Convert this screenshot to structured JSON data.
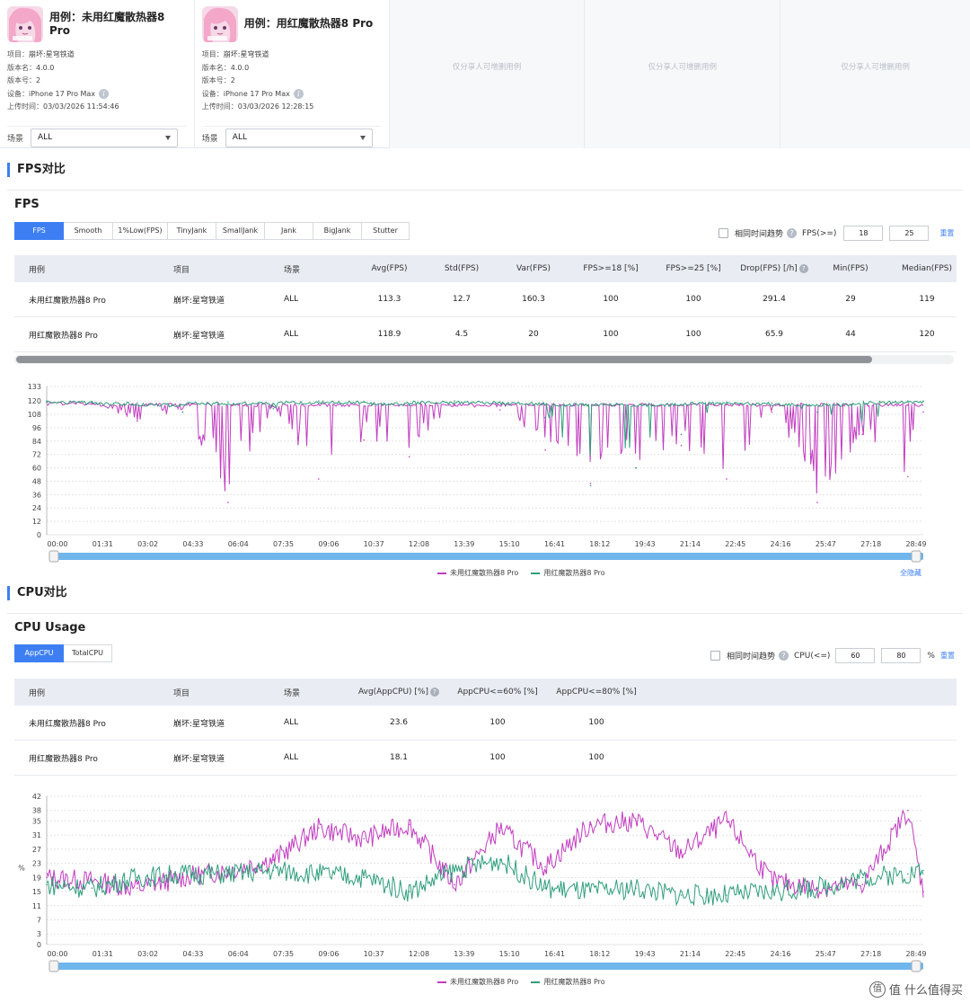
{
  "cases": [
    {
      "title": "用例：未用红魔散热器8 Pro",
      "meta": [
        {
          "label": "项目：",
          "value": "崩坏:星穹铁道"
        },
        {
          "label": "版本名：",
          "value": "4.0.0"
        },
        {
          "label": "版本号：",
          "value": "2"
        },
        {
          "label": "设备：",
          "value": "iPhone 17 Pro Max"
        },
        {
          "label": "上传时间：",
          "value": "03/03/2026 11:54:46"
        }
      ],
      "scene_label": "场景",
      "scene_value": "ALL"
    },
    {
      "title": "用例：用红魔散热器8 Pro",
      "meta": [
        {
          "label": "项目：",
          "value": "崩坏:星穹铁道"
        },
        {
          "label": "版本名：",
          "value": "4.0.0"
        },
        {
          "label": "版本号：",
          "value": "2"
        },
        {
          "label": "设备：",
          "value": "iPhone 17 Pro Max"
        },
        {
          "label": "上传时间：",
          "value": "03/03/2026 12:28:15"
        }
      ],
      "scene_label": "场景",
      "scene_value": "ALL"
    }
  ],
  "empty_slot_text": "仅分享人可增删用例",
  "fps_section": {
    "section_title": "FPS对比",
    "sub_title": "FPS",
    "tabs": [
      "FPS",
      "Smooth",
      "1%Low(FPS)",
      "TinyJank",
      "SmallJank",
      "Jank",
      "BigJank",
      "Stutter"
    ],
    "active_tab": "FPS",
    "trend_label": "相同时间趋势",
    "threshold_label": "FPS(>=)",
    "threshold_values": [
      "18",
      "25"
    ],
    "reset_label": "重置",
    "table": {
      "headers": [
        "用例",
        "项目",
        "场景",
        "Avg(FPS)",
        "Std(FPS)",
        "Var(FPS)",
        "FPS>=18 [%]",
        "FPS>=25 [%]",
        "Drop(FPS) [/h]",
        "Min(FPS)",
        "Median(FPS)"
      ],
      "rows": [
        [
          "未用红魔散热器8 Pro",
          "崩坏:星穹铁道",
          "ALL",
          "113.3",
          "12.7",
          "160.3",
          "100",
          "100",
          "291.4",
          "29",
          "119"
        ],
        [
          "用红魔散热器8 Pro",
          "崩坏:星穹铁道",
          "ALL",
          "118.9",
          "4.5",
          "20",
          "100",
          "100",
          "65.9",
          "44",
          "120"
        ]
      ]
    },
    "legend": [
      "未用红魔散热器8 Pro",
      "用红魔散热器8 Pro"
    ],
    "hide_all_label": "全隐藏"
  },
  "cpu_section": {
    "section_title": "CPU对比",
    "sub_title": "CPU Usage",
    "tabs": [
      "AppCPU",
      "TotalCPU"
    ],
    "active_tab": "AppCPU",
    "trend_label": "相同时间趋势",
    "threshold_label": "CPU(<=)",
    "threshold_values": [
      "60",
      "80"
    ],
    "unit_label": "%",
    "reset_label": "重置",
    "table": {
      "headers": [
        "用例",
        "项目",
        "场景",
        "Avg(AppCPU) [%]",
        "AppCPU<=60% [%]",
        "AppCPU<=80% [%]"
      ],
      "rows": [
        [
          "未用红魔散热器8 Pro",
          "崩坏:星穹铁道",
          "ALL",
          "23.6",
          "100",
          "100"
        ],
        [
          "用红魔散热器8 Pro",
          "崩坏:星穹铁道",
          "ALL",
          "18.1",
          "100",
          "100"
        ]
      ]
    },
    "legend": [
      "未用红魔散热器8 Pro",
      "用红魔散热器8 Pro"
    ]
  },
  "colors": {
    "accent": "#3d7ff3",
    "series_without_cooler": "#c13cc0",
    "series_with_cooler": "#2f9e7b"
  },
  "watermark": "值 什么值得买",
  "chart_data": [
    {
      "type": "line",
      "ylabel": "",
      "xlabel": "",
      "ylim": [
        0,
        133
      ],
      "yticks": [
        0,
        12,
        24,
        36,
        48,
        60,
        72,
        84,
        96,
        108,
        120,
        133
      ],
      "xticks": [
        "00:00",
        "01:31",
        "03:02",
        "04:33",
        "06:04",
        "07:35",
        "09:06",
        "10:37",
        "12:08",
        "13:39",
        "15:10",
        "16:41",
        "18:12",
        "19:43",
        "21:14",
        "22:45",
        "24:16",
        "25:47",
        "27:18",
        "28:49"
      ],
      "x": [
        0,
        91,
        182,
        273,
        364,
        455,
        546,
        637,
        728,
        819,
        910,
        1001,
        1092,
        1183,
        1274,
        1365,
        1456,
        1547,
        1638,
        1729,
        1760
      ],
      "series": [
        {
          "name": "未用红魔散热器8 Pro",
          "values": [
            119,
            118,
            102,
            110,
            29,
            115,
            50,
            85,
            70,
            116,
            112,
            76,
            46,
            60,
            80,
            50,
            110,
            29,
            90,
            52,
            110
          ]
        },
        {
          "name": "用红魔散热器8 Pro",
          "values": [
            120,
            119,
            118,
            110,
            119,
            113,
            120,
            119,
            116,
            120,
            119,
            105,
            44,
            60,
            90,
            119,
            118,
            110,
            97,
            120,
            120
          ]
        }
      ]
    },
    {
      "type": "line",
      "ylabel": "%",
      "xlabel": "",
      "ylim": [
        0,
        42
      ],
      "yticks": [
        0,
        3,
        7,
        11,
        15,
        19,
        23,
        27,
        31,
        35,
        38,
        42
      ],
      "xticks": [
        "00:00",
        "01:31",
        "03:02",
        "04:33",
        "06:04",
        "07:35",
        "09:06",
        "10:37",
        "12:08",
        "13:39",
        "15:10",
        "16:41",
        "18:12",
        "19:43",
        "21:14",
        "22:45",
        "24:16",
        "25:47",
        "27:18",
        "28:49"
      ],
      "x": [
        0,
        91,
        182,
        273,
        364,
        455,
        546,
        637,
        728,
        819,
        910,
        1001,
        1092,
        1183,
        1274,
        1365,
        1456,
        1547,
        1638,
        1729,
        1760
      ],
      "series": [
        {
          "name": "未用红魔散热器8 Pro",
          "values": [
            19,
            18,
            16,
            19,
            21,
            24,
            33,
            30,
            34,
            17,
            33,
            22,
            34,
            35,
            26,
            35,
            18,
            16,
            17,
            38,
            15
          ]
        },
        {
          "name": "用红魔散热器8 Pro",
          "values": [
            17,
            16,
            19,
            20,
            20,
            21,
            20,
            19,
            15,
            21,
            24,
            16,
            15,
            16,
            14,
            14,
            15,
            16,
            19,
            20,
            21
          ]
        }
      ]
    }
  ]
}
